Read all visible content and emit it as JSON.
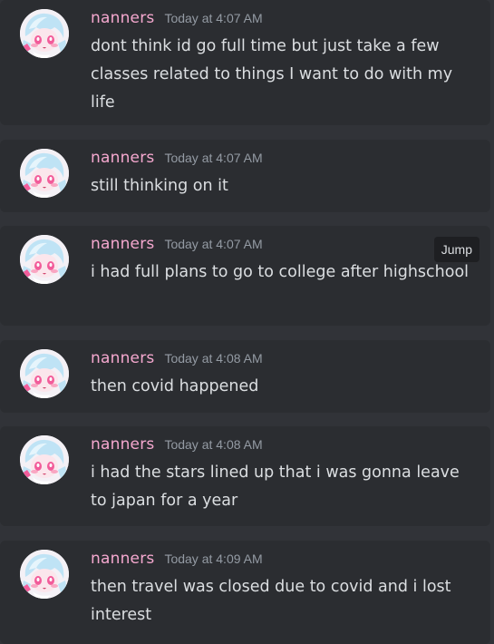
{
  "accent": {
    "username_color": "#f5a8cf",
    "message_bg": "#2b2d31",
    "page_bg": "#313338"
  },
  "messages": [
    {
      "author": "nanners",
      "timestamp": "Today at 4:07 AM",
      "text": "dont think id go full time but just take a few classes related to things I want to do with my life"
    },
    {
      "author": "nanners",
      "timestamp": "Today at 4:07 AM",
      "text": "still thinking on it"
    },
    {
      "author": "nanners",
      "timestamp": "Today at 4:07 AM",
      "text": "i had full plans to go to college after highschool",
      "jump_label": "Jump"
    },
    {
      "author": "nanners",
      "timestamp": "Today at 4:08 AM",
      "text": "then covid happened"
    },
    {
      "author": "nanners",
      "timestamp": "Today at 4:08 AM",
      "text": "i had the stars lined up that i was gonna leave to japan for a year"
    },
    {
      "author": "nanners",
      "timestamp": "Today at 4:09 AM",
      "text": "then travel was closed due to covid and i lost interest"
    }
  ]
}
